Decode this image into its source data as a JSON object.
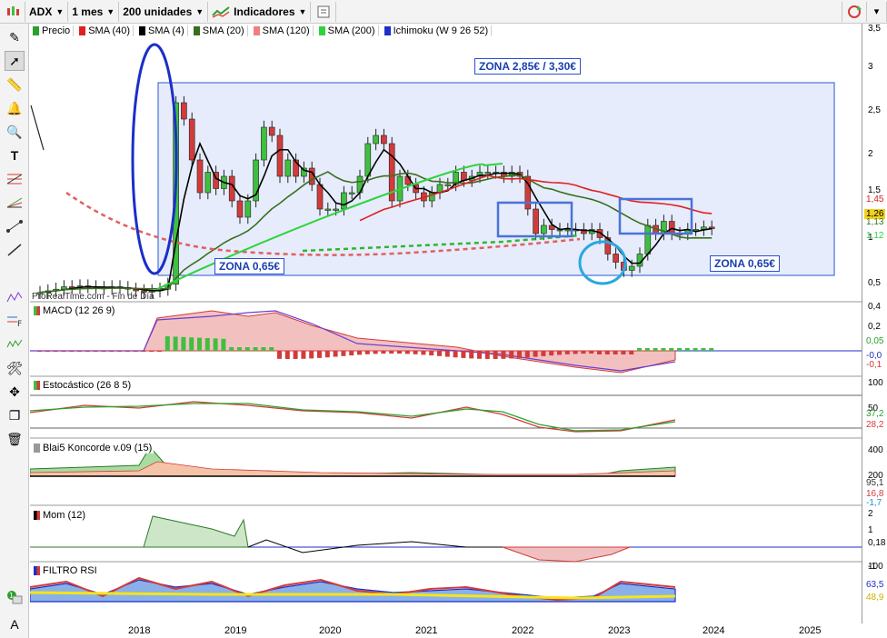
{
  "toolbar": {
    "ticker": "ADX",
    "timeframe": "1 mes",
    "units": "200 unidades",
    "indicators": "Indicadores"
  },
  "legend": [
    {
      "label": "Precio",
      "color": "#2ca02c"
    },
    {
      "label": "SMA (40)",
      "color": "#e02020"
    },
    {
      "label": "SMA (4)",
      "color": "#000000"
    },
    {
      "label": "SMA (20)",
      "color": "#3a6e1e"
    },
    {
      "label": "SMA (120)",
      "color": "#f08080"
    },
    {
      "label": "SMA (200)",
      "color": "#2fd33f"
    },
    {
      "label": "Ichimoku (W 9 26 52)",
      "color": "#1e2ec8"
    }
  ],
  "watermark": "ProRealTime.com - Fin de Día",
  "zones": {
    "top": "ZONA 2,85€ / 3,30€",
    "left": "ZONA 0,65€",
    "right": "ZONA 0,65€"
  },
  "price_axis": [
    "3,5",
    "3",
    "2,5",
    "2",
    "1,5",
    "1",
    "0,5"
  ],
  "price_tags": [
    {
      "text": "1,45",
      "color": "#e02020"
    },
    {
      "text": "1,26",
      "color": "#000000"
    },
    {
      "text": "1,13",
      "color": "#3a6e1e"
    },
    {
      "text": "1,12",
      "color": "#2fd33f"
    }
  ],
  "panels": {
    "macd": {
      "title": "MACD (12 26 9)",
      "axis": [
        "0,4",
        "0,2"
      ],
      "tags": [
        "0,05",
        "-0,0",
        "-0,1"
      ]
    },
    "stoch": {
      "title": "Estocástico (26 8 5)",
      "axis": [
        "100",
        "50"
      ],
      "tags": [
        "37,2",
        "28,2"
      ]
    },
    "koncorde": {
      "title": "Blai5 Koncorde v.09 (15)",
      "axis": [
        "400",
        "200"
      ],
      "tags": [
        "95,1",
        "16,8",
        "-1,7"
      ]
    },
    "mom": {
      "title": "Mom (12)",
      "axis": [
        "2",
        "1",
        "0,18",
        "-1"
      ]
    },
    "rsi": {
      "title": "FILTRO RSI",
      "axis": [
        "100"
      ],
      "tags": [
        "63,5",
        "48,9"
      ]
    }
  },
  "x_axis": [
    "2018",
    "2019",
    "2020",
    "2021",
    "2022",
    "2023",
    "2024",
    "2025"
  ],
  "colors": {
    "up_candle": "#3fbf3f",
    "down_candle": "#d23b3b",
    "zone_fill": "#e6ecfb",
    "zone_border": "#4a72d8",
    "accent_blue": "#1a2fc8"
  }
}
